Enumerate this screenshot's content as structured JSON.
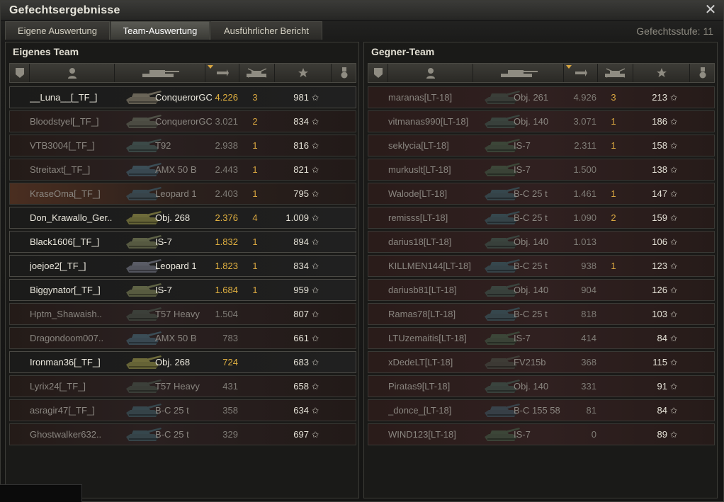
{
  "window": {
    "title": "Gefechtsergebnisse"
  },
  "tabs": [
    {
      "label": "Eigene Auswertung",
      "active": false
    },
    {
      "label": "Team-Auswertung",
      "active": true
    },
    {
      "label": "Ausführlicher Bericht",
      "active": false
    }
  ],
  "battle_level": "Gefechtsstufe: 11",
  "colors": {
    "damage_alive": "#e0b040",
    "kills": "#d8a640",
    "dead_text": "#8a8680",
    "alive_text": "#ece9de"
  },
  "header_icons": [
    "platoon-icon",
    "player-icon",
    "tank-icon",
    "damage-icon",
    "kills-icon",
    "xp-star-icon",
    "medal-icon"
  ],
  "own_team": {
    "title": "Eigenes Team",
    "players": [
      {
        "name": "__Luna__[_TF_]",
        "vehicle": "ConquerorGC",
        "damage": "4.226",
        "kills": "3",
        "xp": "981",
        "alive": true,
        "platoon": false,
        "tank_color": "#6a6558"
      },
      {
        "name": "Bloodstyel[_TF_]",
        "vehicle": "ConquerorGC",
        "damage": "3.021",
        "kills": "2",
        "xp": "834",
        "alive": false,
        "platoon": false,
        "tank_color": "#4f5046"
      },
      {
        "name": "VTB3004[_TF_]",
        "vehicle": "T92",
        "damage": "2.938",
        "kills": "1",
        "xp": "816",
        "alive": false,
        "platoon": false,
        "tank_color": "#3c4a48"
      },
      {
        "name": "Streitaxt[_TF_]",
        "vehicle": "AMX 50 B",
        "damage": "2.443",
        "kills": "1",
        "xp": "821",
        "alive": false,
        "platoon": false,
        "tank_color": "#3b4d56"
      },
      {
        "name": "KraseOma[_TF_]",
        "vehicle": "Leopard 1",
        "damage": "2.403",
        "kills": "1",
        "xp": "795",
        "alive": false,
        "platoon": true,
        "tank_color": "#384850"
      },
      {
        "name": "Don_Krawallo_Ger..",
        "vehicle": "Obj. 268",
        "damage": "2.376",
        "kills": "4",
        "xp": "1.009",
        "alive": true,
        "platoon": false,
        "tank_color": "#6e6b3a"
      },
      {
        "name": "Black1606[_TF_]",
        "vehicle": "IS-7",
        "damage": "1.832",
        "kills": "1",
        "xp": "894",
        "alive": true,
        "platoon": false,
        "tank_color": "#5d6146"
      },
      {
        "name": "joejoe2[_TF_]",
        "vehicle": "Leopard 1",
        "damage": "1.823",
        "kills": "1",
        "xp": "834",
        "alive": true,
        "platoon": false,
        "tank_color": "#5a5c66"
      },
      {
        "name": "Biggynator[_TF_]",
        "vehicle": "IS-7",
        "damage": "1.684",
        "kills": "1",
        "xp": "959",
        "alive": true,
        "platoon": false,
        "tank_color": "#5f6345"
      },
      {
        "name": "Hptm_Shawaish..",
        "vehicle": "T57 Heavy",
        "damage": "1.504",
        "kills": "",
        "xp": "807",
        "alive": false,
        "platoon": false,
        "tank_color": "#3c403a"
      },
      {
        "name": "Dragondoom007..",
        "vehicle": "AMX 50 B",
        "damage": "783",
        "kills": "",
        "xp": "661",
        "alive": false,
        "platoon": false,
        "tank_color": "#3b4d56"
      },
      {
        "name": "Ironman36[_TF_]",
        "vehicle": "Obj. 268",
        "damage": "724",
        "kills": "",
        "xp": "683",
        "alive": true,
        "platoon": false,
        "tank_color": "#6e6b3a"
      },
      {
        "name": "Lyrix24[_TF_]",
        "vehicle": "T57 Heavy",
        "damage": "431",
        "kills": "",
        "xp": "658",
        "alive": false,
        "platoon": false,
        "tank_color": "#3c403a"
      },
      {
        "name": "asragir47[_TF_]",
        "vehicle": "B-C 25 t",
        "damage": "358",
        "kills": "",
        "xp": "634",
        "alive": false,
        "platoon": false,
        "tank_color": "#36474d"
      },
      {
        "name": "Ghostwalker632..",
        "vehicle": "B-C 25 t",
        "damage": "329",
        "kills": "",
        "xp": "697",
        "alive": false,
        "platoon": false,
        "tank_color": "#36474d"
      }
    ]
  },
  "enemy_team": {
    "title": "Gegner-Team",
    "players": [
      {
        "name": "maranas[LT-18]",
        "vehicle": "Obj. 261",
        "damage": "4.926",
        "kills": "3",
        "xp": "213",
        "alive": false,
        "platoon": false,
        "tank_color": "#3a3e38"
      },
      {
        "name": "vitmanas990[LT-18]",
        "vehicle": "Obj. 140",
        "damage": "3.071",
        "kills": "1",
        "xp": "186",
        "alive": false,
        "platoon": false,
        "tank_color": "#3a443e"
      },
      {
        "name": "seklycia[LT-18]",
        "vehicle": "IS-7",
        "damage": "2.311",
        "kills": "1",
        "xp": "158",
        "alive": false,
        "platoon": false,
        "tank_color": "#3c4638"
      },
      {
        "name": "murkuslt[LT-18]",
        "vehicle": "IS-7",
        "damage": "1.500",
        "kills": "",
        "xp": "138",
        "alive": false,
        "platoon": false,
        "tank_color": "#3c4638"
      },
      {
        "name": "Walode[LT-18]",
        "vehicle": "B-C 25 t",
        "damage": "1.461",
        "kills": "1",
        "xp": "147",
        "alive": false,
        "platoon": false,
        "tank_color": "#36474d"
      },
      {
        "name": "remisss[LT-18]",
        "vehicle": "B-C 25 t",
        "damage": "1.090",
        "kills": "2",
        "xp": "159",
        "alive": false,
        "platoon": false,
        "tank_color": "#36474d"
      },
      {
        "name": "darius18[LT-18]",
        "vehicle": "Obj. 140",
        "damage": "1.013",
        "kills": "",
        "xp": "106",
        "alive": false,
        "platoon": false,
        "tank_color": "#3a443e"
      },
      {
        "name": "KILLMEN144[LT-18]",
        "vehicle": "B-C 25 t",
        "damage": "938",
        "kills": "1",
        "xp": "123",
        "alive": false,
        "platoon": false,
        "tank_color": "#36474d"
      },
      {
        "name": "dariusb81[LT-18]",
        "vehicle": "Obj. 140",
        "damage": "904",
        "kills": "",
        "xp": "126",
        "alive": false,
        "platoon": false,
        "tank_color": "#3a443e"
      },
      {
        "name": "Ramas78[LT-18]",
        "vehicle": "B-C 25 t",
        "damage": "818",
        "kills": "",
        "xp": "103",
        "alive": false,
        "platoon": false,
        "tank_color": "#36474d"
      },
      {
        "name": "LTUzemaitis[LT-18]",
        "vehicle": "IS-7",
        "damage": "414",
        "kills": "",
        "xp": "84",
        "alive": false,
        "platoon": false,
        "tank_color": "#3c4638"
      },
      {
        "name": "xDedeLT[LT-18]",
        "vehicle": "FV215b",
        "damage": "368",
        "kills": "",
        "xp": "115",
        "alive": false,
        "platoon": false,
        "tank_color": "#3e3c36"
      },
      {
        "name": "Piratas9[LT-18]",
        "vehicle": "Obj. 140",
        "damage": "331",
        "kills": "",
        "xp": "91",
        "alive": false,
        "platoon": false,
        "tank_color": "#3a443e"
      },
      {
        "name": "_donce_[LT-18]",
        "vehicle": "B-C 155 58",
        "damage": "81",
        "kills": "",
        "xp": "84",
        "alive": false,
        "platoon": false,
        "tank_color": "#38424a"
      },
      {
        "name": "WIND123[LT-18]",
        "vehicle": "IS-7",
        "damage": "0",
        "kills": "",
        "xp": "89",
        "alive": false,
        "platoon": false,
        "tank_color": "#3c4638"
      }
    ]
  }
}
